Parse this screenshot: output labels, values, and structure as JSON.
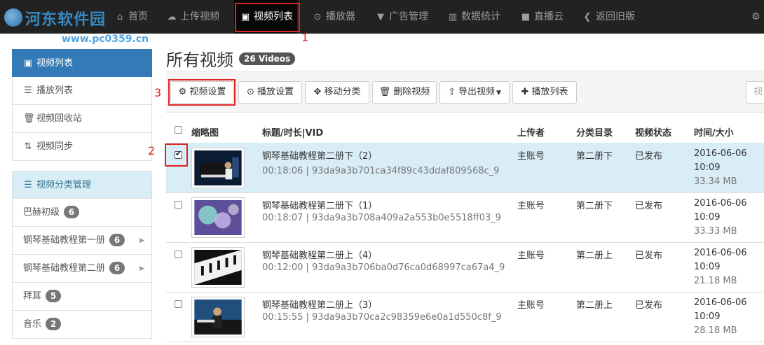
{
  "watermark": {
    "text": "河东软件园",
    "url": "www.pc0359.cn"
  },
  "nav": {
    "items": [
      {
        "label": "首页",
        "icon": "home-icon"
      },
      {
        "label": "上传视频",
        "icon": "upload-icon"
      },
      {
        "label": "视频列表",
        "icon": "film-icon",
        "active": true
      },
      {
        "label": "播放器",
        "icon": "play-circle-icon"
      },
      {
        "label": "广告管理",
        "icon": "filter-icon"
      },
      {
        "label": "数据统计",
        "icon": "bar-chart-icon"
      },
      {
        "label": "直播云",
        "icon": "video-camera-icon"
      },
      {
        "label": "返回旧版",
        "icon": "back-icon"
      }
    ]
  },
  "annotations": [
    "1",
    "2",
    "3"
  ],
  "sidebar": {
    "main_items": [
      {
        "label": "视频列表",
        "icon": "film-icon",
        "active": true
      },
      {
        "label": "播放列表",
        "icon": "list-icon"
      },
      {
        "label": "视频回收站",
        "icon": "trash-icon"
      },
      {
        "label": "视频同步",
        "icon": "sync-icon"
      }
    ],
    "category_header": {
      "label": "视频分类管理",
      "icon": "menu-icon"
    },
    "categories": [
      {
        "label": "巴赫初级",
        "count": "6",
        "has_children": false
      },
      {
        "label": "钢琴基础教程第一册",
        "count": "6",
        "has_children": true
      },
      {
        "label": "钢琴基础教程第二册",
        "count": "6",
        "has_children": true
      },
      {
        "label": "拜耳",
        "count": "5",
        "has_children": false
      },
      {
        "label": "音乐",
        "count": "2",
        "has_children": false
      }
    ]
  },
  "main": {
    "title": "所有视频",
    "count_badge": "26 Videos",
    "toolbar": {
      "video_settings": "视频设置",
      "play_settings": "播放设置",
      "move_category": "移动分类",
      "delete_video": "删除视频",
      "export_video": "导出视频",
      "playlist": "播放列表",
      "search_placeholder": "视"
    },
    "table": {
      "headers": {
        "thumbnail": "缩略图",
        "title": "标题/时长|VID",
        "uploader": "上传者",
        "category": "分类目录",
        "status": "视频状态",
        "time_size": "时间/大小"
      },
      "rows": [
        {
          "title": "钢琴基础教程第二册下（2）",
          "duration_vid": "00:18:06 | 93da9a3b701ca34f89c43ddaf809568c_9",
          "uploader": "主账号",
          "category": "第二册下",
          "status": "已发布",
          "date": "2016-06-06",
          "time": "10:09",
          "size": "33.34 MB",
          "checked": true
        },
        {
          "title": "钢琴基础教程第二册下（1）",
          "duration_vid": "00:18:07 | 93da9a3b708a409a2a553b0e5518ff03_9",
          "uploader": "主账号",
          "category": "第二册下",
          "status": "已发布",
          "date": "2016-06-06",
          "time": "10:09",
          "size": "33.33 MB",
          "checked": false
        },
        {
          "title": "钢琴基础教程第二册上（4）",
          "duration_vid": "00:12:00 | 93da9a3b706ba0d76ca0d68997ca67a4_9",
          "uploader": "主账号",
          "category": "第二册上",
          "status": "已发布",
          "date": "2016-06-06",
          "time": "10:09",
          "size": "21.18 MB",
          "checked": false
        },
        {
          "title": "钢琴基础教程第二册上（3）",
          "duration_vid": "00:15:55 | 93da9a3b70ca2c98359e6e0a1d550c8f_9",
          "uploader": "主账号",
          "category": "第二册上",
          "status": "已发布",
          "date": "2016-06-06",
          "time": "10:09",
          "size": "28.18 MB",
          "checked": false
        }
      ]
    }
  },
  "colors": {
    "navbar": "#222222",
    "accent": "#337ab7",
    "selected_row": "#d9edf7",
    "annotation": "#e02424"
  }
}
